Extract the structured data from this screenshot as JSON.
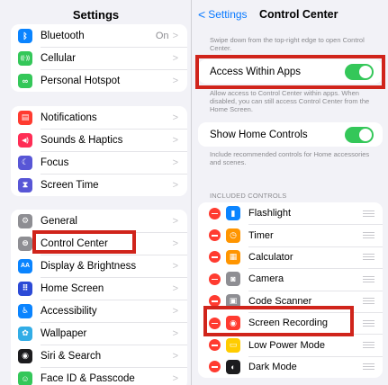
{
  "left": {
    "title": "Settings",
    "group1": [
      {
        "label": "Bluetooth",
        "value": "On",
        "icon": "bluetooth-icon",
        "color": "#0a84ff",
        "glyph": "ᛒ"
      },
      {
        "label": "Cellular",
        "value": "",
        "icon": "cellular-icon",
        "color": "#34c759",
        "glyph": "((·))"
      },
      {
        "label": "Personal Hotspot",
        "value": "",
        "icon": "hotspot-icon",
        "color": "#34c759",
        "glyph": "∞"
      }
    ],
    "group2": [
      {
        "label": "Notifications",
        "icon": "notifications-icon",
        "color": "#ff3b30",
        "glyph": "▤"
      },
      {
        "label": "Sounds & Haptics",
        "icon": "sounds-icon",
        "color": "#ff2d55",
        "glyph": "◀)"
      },
      {
        "label": "Focus",
        "icon": "focus-icon",
        "color": "#5856d6",
        "glyph": "☾"
      },
      {
        "label": "Screen Time",
        "icon": "screen-time-icon",
        "color": "#5856d6",
        "glyph": "⧗"
      }
    ],
    "group3": [
      {
        "label": "General",
        "icon": "general-icon",
        "color": "#8e8e93",
        "glyph": "⚙"
      },
      {
        "label": "Control Center",
        "icon": "control-center-icon",
        "color": "#8e8e93",
        "glyph": "⊜"
      },
      {
        "label": "Display & Brightness",
        "icon": "display-icon",
        "color": "#0a84ff",
        "glyph": "AA"
      },
      {
        "label": "Home Screen",
        "icon": "home-screen-icon",
        "color": "#2c4ad6",
        "glyph": "⠿"
      },
      {
        "label": "Accessibility",
        "icon": "accessibility-icon",
        "color": "#0a84ff",
        "glyph": "♿"
      },
      {
        "label": "Wallpaper",
        "icon": "wallpaper-icon",
        "color": "#32ade6",
        "glyph": "✿"
      },
      {
        "label": "Siri & Search",
        "icon": "siri-icon",
        "color": "#1c1c1e",
        "glyph": "◉"
      },
      {
        "label": "Face ID & Passcode",
        "icon": "face-id-icon",
        "color": "#34c759",
        "glyph": "☺"
      }
    ]
  },
  "right": {
    "back_label": "Settings",
    "title": "Control Center",
    "intro_note": "Swipe down from the top-right edge to open Control Center.",
    "access_within_apps": {
      "label": "Access Within Apps",
      "on": true
    },
    "access_note": "Allow access to Control Center within apps. When disabled, you can still access Control Center from the Home Screen.",
    "show_home_controls": {
      "label": "Show Home Controls",
      "on": true
    },
    "home_note": "Include recommended controls for Home accessories and scenes.",
    "included_header": "INCLUDED CONTROLS",
    "controls": [
      {
        "label": "Flashlight",
        "icon": "flashlight-icon",
        "color": "#0a84ff",
        "glyph": "▮"
      },
      {
        "label": "Timer",
        "icon": "timer-icon",
        "color": "#ff9500",
        "glyph": "◷"
      },
      {
        "label": "Calculator",
        "icon": "calculator-icon",
        "color": "#ff9500",
        "glyph": "▦"
      },
      {
        "label": "Camera",
        "icon": "camera-icon",
        "color": "#8e8e93",
        "glyph": "◙"
      },
      {
        "label": "Code Scanner",
        "icon": "code-scanner-icon",
        "color": "#8e8e93",
        "glyph": "▣"
      },
      {
        "label": "Screen Recording",
        "icon": "screen-recording-icon",
        "color": "#ff3b30",
        "glyph": "◉"
      },
      {
        "label": "Low Power Mode",
        "icon": "low-power-icon",
        "color": "#ffcc00",
        "glyph": "▭"
      },
      {
        "label": "Dark Mode",
        "icon": "dark-mode-icon",
        "color": "#1c1c1e",
        "glyph": "◐"
      }
    ]
  }
}
